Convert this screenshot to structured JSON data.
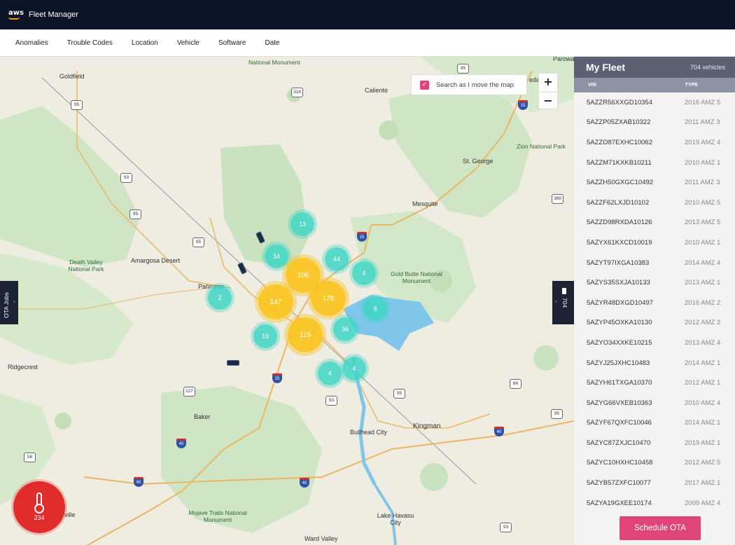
{
  "app": {
    "logo": "aws",
    "title": "Fleet Manager"
  },
  "filters": [
    "Anomalies",
    "Trouble Codes",
    "Location",
    "Vehicle",
    "Software",
    "Date"
  ],
  "map": {
    "search_label": "Search as I move the map",
    "search_checked": true,
    "zoom_in": "+",
    "zoom_out": "−",
    "ota_tab_label": "OTA Jobs",
    "fleet_tab_count": "704",
    "temperature_count": "234",
    "places": [
      "Goldfield",
      "Caliente",
      "St. George",
      "Mesquite",
      "Amargosa Desert",
      "Pahrump",
      "Ridgecrest",
      "Baker",
      "Kingman",
      "Bullhead City",
      "Lake Havasu City",
      "Ward Valley",
      "rville",
      "Parowa",
      "edar"
    ],
    "parks": [
      "National Monument",
      "Zion National Park",
      "Death Valley National Park",
      "Gold Butte National Monument",
      "Mojave Trails National Monument"
    ],
    "highway_shields": [
      "95",
      "318",
      "93",
      "15",
      "389",
      "95",
      "95",
      "15",
      "127",
      "15",
      "95",
      "93",
      "66",
      "40",
      "40",
      "40",
      "40",
      "95",
      "58",
      "93",
      "95"
    ],
    "clusters": {
      "gold": [
        "106",
        "147",
        "176",
        "115"
      ],
      "teal": [
        "13",
        "34",
        "44",
        "4",
        "2",
        "9",
        "36",
        "19",
        "4",
        "4"
      ]
    }
  },
  "fleet": {
    "title": "My Fleet",
    "count_label": "704 vehicles",
    "col_vin": "VIN",
    "col_type": "TYPE",
    "vehicles": [
      {
        "vin": "5AZZR56XXGD10354",
        "type": "2016 AMZ 5"
      },
      {
        "vin": "5AZZP05ZXAB10322",
        "type": "2011 AMZ 3"
      },
      {
        "vin": "5AZZO87EXHC10062",
        "type": "2019 AMZ 4"
      },
      {
        "vin": "5AZZM71KXKB10211",
        "type": "2010 AMZ 1"
      },
      {
        "vin": "5AZZH50GXGC10492",
        "type": "2011 AMZ 3"
      },
      {
        "vin": "5AZZF62LXJD10102",
        "type": "2010 AMZ 5"
      },
      {
        "vin": "5AZZD98RXDA10126",
        "type": "2013 AMZ 5"
      },
      {
        "vin": "5AZYX61KXCD10019",
        "type": "2010 AMZ 1"
      },
      {
        "vin": "5AZYT97IXGA10383",
        "type": "2014 AMZ 4"
      },
      {
        "vin": "5AZYS35SXJA10133",
        "type": "2013 AMZ 1"
      },
      {
        "vin": "5AZYR48DXGD10497",
        "type": "2016 AMZ 2"
      },
      {
        "vin": "5AZYP45OXKA10130",
        "type": "2012 AMZ 2"
      },
      {
        "vin": "5AZYO34XXKE10215",
        "type": "2013 AMZ 4"
      },
      {
        "vin": "5AZYJ25JXHC10483",
        "type": "2014 AMZ 1"
      },
      {
        "vin": "5AZYH61TXGA10370",
        "type": "2012 AMZ 1"
      },
      {
        "vin": "5AZYG66VXEB10363",
        "type": "2010 AMZ 4"
      },
      {
        "vin": "5AZYF67QXFC10046",
        "type": "2014 AMZ 1"
      },
      {
        "vin": "5AZYC87ZXJC10470",
        "type": "2019 AMZ 1"
      },
      {
        "vin": "5AZYC10HXHC10458",
        "type": "2012 AMZ 5"
      },
      {
        "vin": "5AZYB57ZXFC10077",
        "type": "2017 AMZ 1"
      },
      {
        "vin": "5AZYA19GXEE10174",
        "type": "2009 AMZ 4"
      }
    ],
    "schedule_button": "Schedule OTA"
  },
  "colors": {
    "topbar": "#0b1326",
    "accent_pink": "#e0457a",
    "cluster_teal": "#3ed6c4",
    "cluster_gold": "#fbc41c",
    "alert_red": "#e12c2c",
    "panel_header": "#5b6072"
  }
}
